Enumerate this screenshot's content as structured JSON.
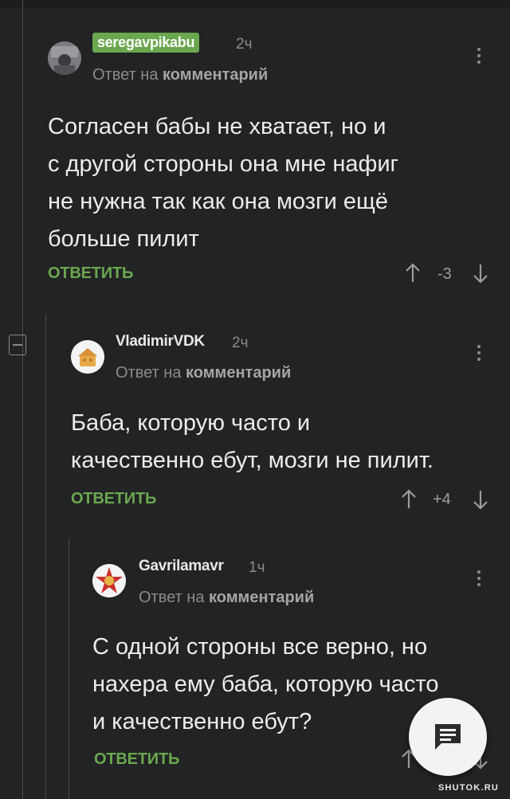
{
  "comments": [
    {
      "username": "seregavpikabu",
      "time": "2ч",
      "reply_prefix": "Ответ на",
      "reply_target": "комментарий",
      "body_lines": [
        "Согласен бабы не хватает, но и",
        "с другой стороны она мне нафиг",
        "не нужна так как она мозги ещё",
        "больше пилит"
      ],
      "reply_label": "ОТВЕТИТЬ",
      "rating": "-3"
    },
    {
      "username": "VladimirVDK",
      "time": "2ч",
      "reply_prefix": "Ответ на",
      "reply_target": "комментарий",
      "body_lines": [
        "Баба, которую часто и",
        "качественно ебут, мозги не пилит."
      ],
      "reply_label": "ОТВЕТИТЬ",
      "rating": "+4"
    },
    {
      "username": "Gavrilamavr",
      "time": "1ч",
      "reply_prefix": "Ответ на",
      "reply_target": "комментарий",
      "body_lines": [
        "С одной стороны все верно, но",
        "нахера ему баба, которую часто",
        "и качественно ебут?"
      ],
      "reply_label": "ОТВЕТИТЬ",
      "rating": ""
    }
  ],
  "watermark": "SHUTOK.RU",
  "icons": {
    "upvote": "arrow-up-icon",
    "downvote": "arrow-down-icon",
    "more": "more-vertical-icon",
    "collapse": "minus-square-icon",
    "fab": "chat-bubble-icon"
  },
  "colors": {
    "background": "#222325",
    "accent_green": "#6aa84f",
    "muted_text": "#8a8b8d"
  }
}
